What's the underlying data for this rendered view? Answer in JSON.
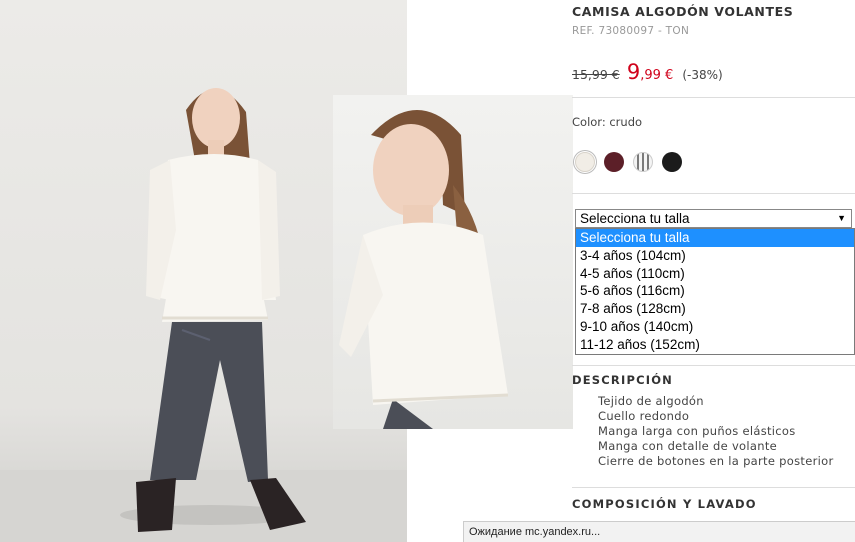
{
  "product": {
    "title": "CAMISA ALGODÓN VOLANTES",
    "ref": "REF. 73080097 - TON",
    "old_price": "15,99 €",
    "new_price_main": "9",
    "new_price_cents": ",99 €",
    "discount": "(-38%)",
    "color_label": "Color: crudo",
    "swatches": [
      {
        "icon": "swatch-crudo",
        "color": "#f1ede6"
      },
      {
        "icon": "swatch-burgundy",
        "color": "#5c1f28"
      },
      {
        "icon": "swatch-striped",
        "color": "#9a9a9a"
      },
      {
        "icon": "swatch-black",
        "color": "#1b1b1b"
      }
    ]
  },
  "size_select": {
    "selected": "Selecciona tu talla",
    "options": [
      "Selecciona tu talla",
      "3-4 años (104cm)",
      "4-5 años (110cm)",
      "5-6 años (116cm)",
      "7-8 años (128cm)",
      "9-10 años (140cm)",
      "11-12 años (152cm)"
    ]
  },
  "description": {
    "heading": "DESCRIPCIÓN",
    "items": [
      "Tejido de algodón",
      "Cuello redondo",
      "Manga larga con puños elásticos",
      "Manga con detalle de volante",
      "Cierre de botones en la parte posterior"
    ]
  },
  "composition": {
    "heading": "COMPOSICIÓN Y LAVADO"
  },
  "status_bar": {
    "text": "Ожидание mc.yandex.ru..."
  },
  "colors": {
    "sale_red": "#d0021b",
    "highlight_blue": "#1e90ff"
  }
}
